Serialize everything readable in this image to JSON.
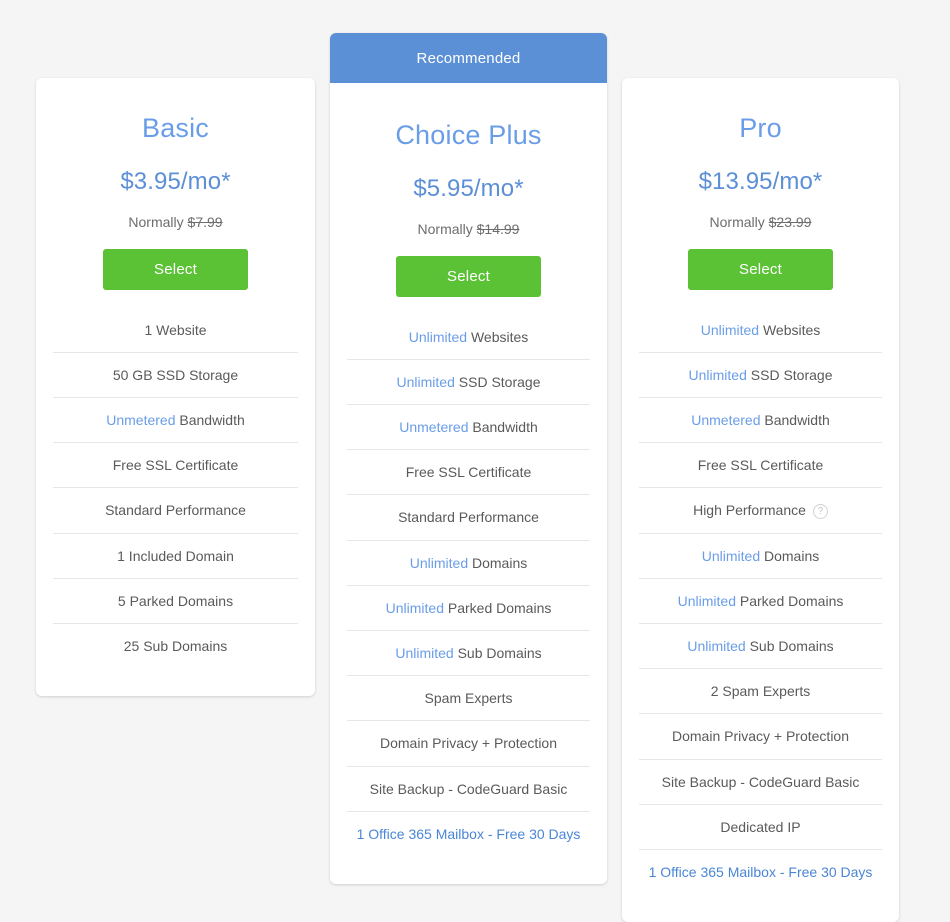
{
  "plans": [
    {
      "id": "basic",
      "title": "Basic",
      "price": "$3.95/mo*",
      "normally_label": "Normally",
      "normally_price": "$7.99",
      "select_label": "Select",
      "banner": null,
      "features": [
        {
          "highlight": "",
          "text": "1 Website"
        },
        {
          "highlight": "",
          "text": "50 GB SSD Storage"
        },
        {
          "highlight": "Unmetered",
          "text": " Bandwidth"
        },
        {
          "highlight": "",
          "text": "Free SSL Certificate"
        },
        {
          "highlight": "",
          "text": "Standard Performance"
        },
        {
          "highlight": "",
          "text": "1 Included Domain"
        },
        {
          "highlight": "",
          "text": "5 Parked Domains"
        },
        {
          "highlight": "",
          "text": "25 Sub Domains"
        }
      ]
    },
    {
      "id": "choiceplus",
      "title": "Choice Plus",
      "price": "$5.95/mo*",
      "normally_label": "Normally",
      "normally_price": "$14.99",
      "select_label": "Select",
      "banner": "Recommended",
      "features": [
        {
          "highlight": "Unlimited",
          "text": " Websites"
        },
        {
          "highlight": "Unlimited",
          "text": " SSD Storage"
        },
        {
          "highlight": "Unmetered",
          "text": " Bandwidth"
        },
        {
          "highlight": "",
          "text": "Free SSL Certificate"
        },
        {
          "highlight": "",
          "text": "Standard Performance"
        },
        {
          "highlight": "Unlimited",
          "text": " Domains"
        },
        {
          "highlight": "Unlimited",
          "text": " Parked Domains"
        },
        {
          "highlight": "Unlimited",
          "text": " Sub Domains"
        },
        {
          "highlight": "",
          "text": "Spam Experts"
        },
        {
          "highlight": "",
          "text": "Domain Privacy + Protection"
        },
        {
          "highlight": "",
          "text": "Site Backup - CodeGuard Basic"
        },
        {
          "highlight": "",
          "text": "1 Office 365 Mailbox - Free 30 Days",
          "all_blue": true
        }
      ]
    },
    {
      "id": "pro",
      "title": "Pro",
      "price": "$13.95/mo*",
      "normally_label": "Normally",
      "normally_price": "$23.99",
      "select_label": "Select",
      "banner": null,
      "features": [
        {
          "highlight": "Unlimited",
          "text": " Websites"
        },
        {
          "highlight": "Unlimited",
          "text": " SSD Storage"
        },
        {
          "highlight": "Unmetered",
          "text": " Bandwidth"
        },
        {
          "highlight": "",
          "text": "Free SSL Certificate"
        },
        {
          "highlight": "",
          "text": "High Performance",
          "help_icon": "?"
        },
        {
          "highlight": "Unlimited",
          "text": " Domains"
        },
        {
          "highlight": "Unlimited",
          "text": " Parked Domains"
        },
        {
          "highlight": "Unlimited",
          "text": " Sub Domains"
        },
        {
          "highlight": "",
          "text": "2 Spam Experts"
        },
        {
          "highlight": "",
          "text": "Domain Privacy + Protection"
        },
        {
          "highlight": "",
          "text": "Site Backup - CodeGuard Basic"
        },
        {
          "highlight": "",
          "text": "Dedicated IP"
        },
        {
          "highlight": "",
          "text": "1 Office 365 Mailbox - Free 30 Days",
          "all_blue": true
        }
      ]
    }
  ],
  "colors": {
    "background": "#f5f5f5",
    "card": "#ffffff",
    "banner_blue": "#5b8fd6",
    "title_blue": "#6a9de8",
    "price_blue": "#5b8fd6",
    "select_green": "#5bc236",
    "feature_text": "#5a5a5a",
    "divider": "#e6e6e6",
    "link_blue": "#4a86d6"
  }
}
